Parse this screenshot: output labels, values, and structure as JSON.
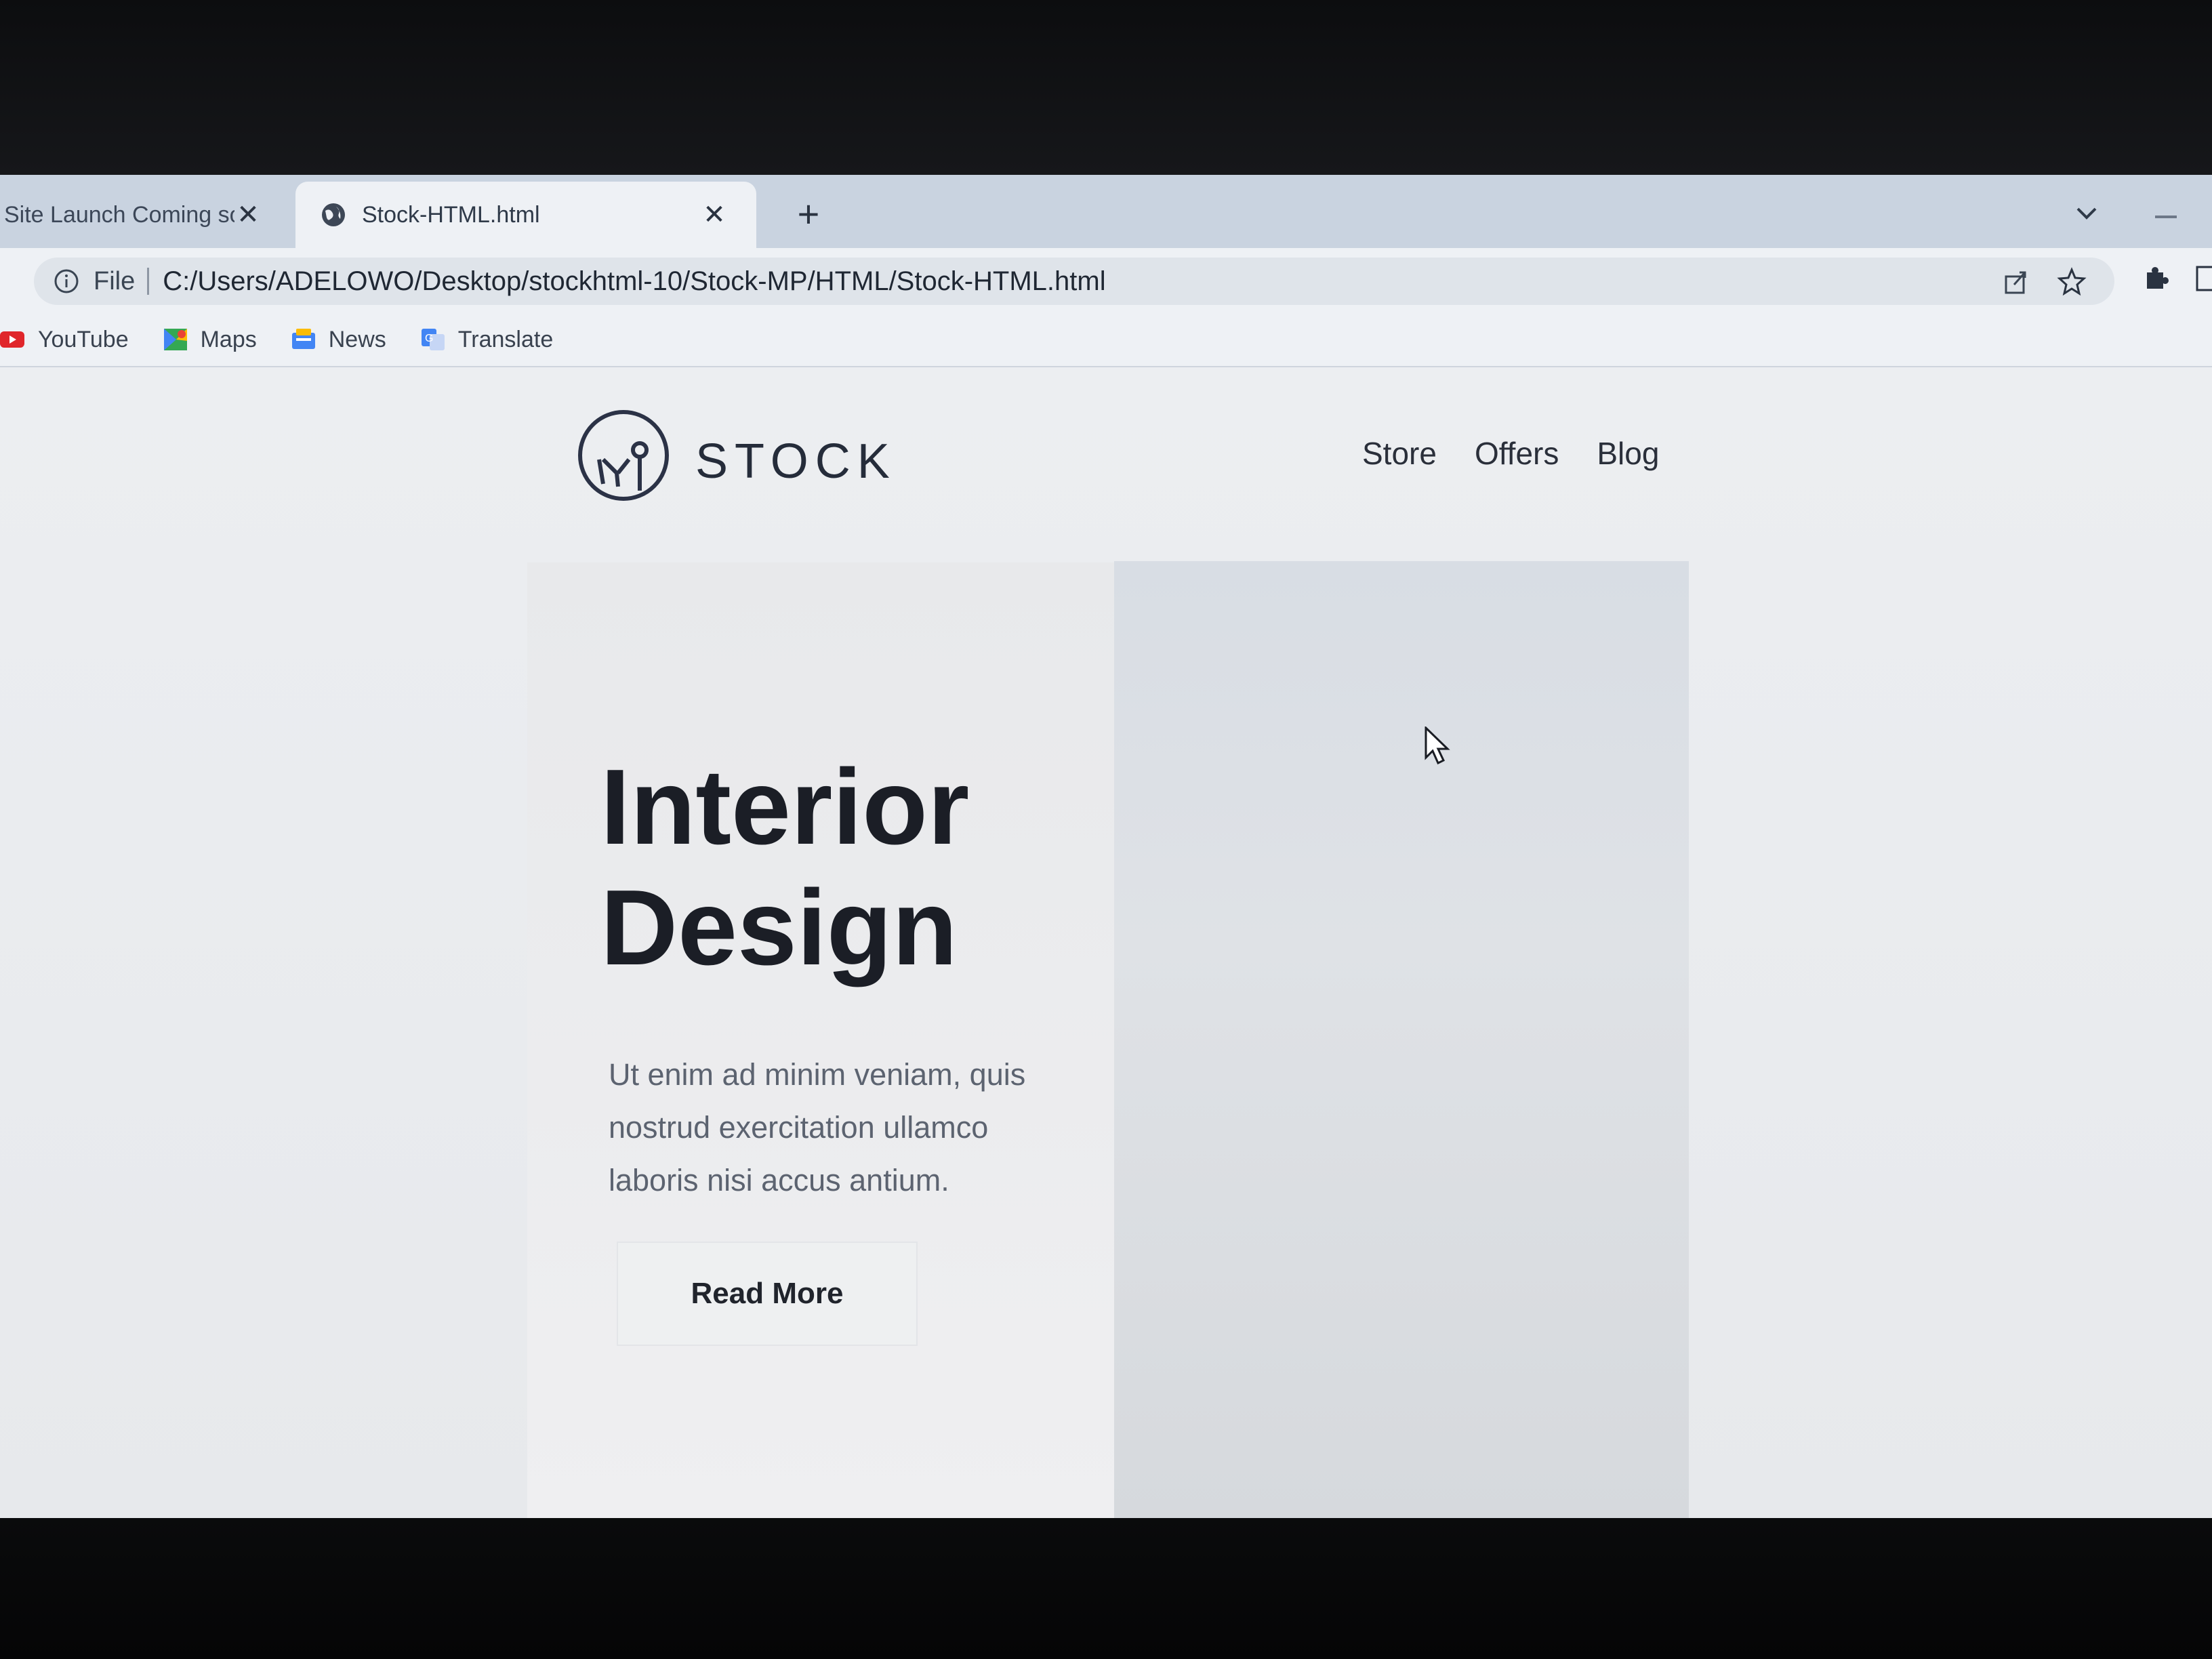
{
  "browser": {
    "tabs": [
      {
        "title": "Site Launch Coming so",
        "active": false
      },
      {
        "title": "Stock-HTML.html",
        "active": true
      }
    ],
    "address_bar": {
      "scheme_label": "File",
      "url": "C:/Users/ADELOWO/Desktop/stockhtml-10/Stock-MP/HTML/Stock-HTML.html"
    },
    "bookmarks": [
      {
        "label": "YouTube",
        "icon": "youtube-icon"
      },
      {
        "label": "Maps",
        "icon": "maps-icon"
      },
      {
        "label": "News",
        "icon": "news-icon"
      },
      {
        "label": "Translate",
        "icon": "translate-icon"
      }
    ]
  },
  "site": {
    "brand": "STOCK",
    "nav": [
      "Store",
      "Offers",
      "Blog"
    ],
    "hero": {
      "title_line1": "Interior",
      "title_line2": "Design",
      "body": "Ut enim ad minim veniam, quis nostrud exercitation ullamco laboris nisi accus antium.",
      "button": "Read More"
    }
  },
  "colors": {
    "tab_strip": "#c9d3e0",
    "toolbar": "#eef1f5",
    "page_bg": "#eceef1",
    "hero_image_panel": "#d8dde4",
    "text_dark": "#1b1e26"
  }
}
